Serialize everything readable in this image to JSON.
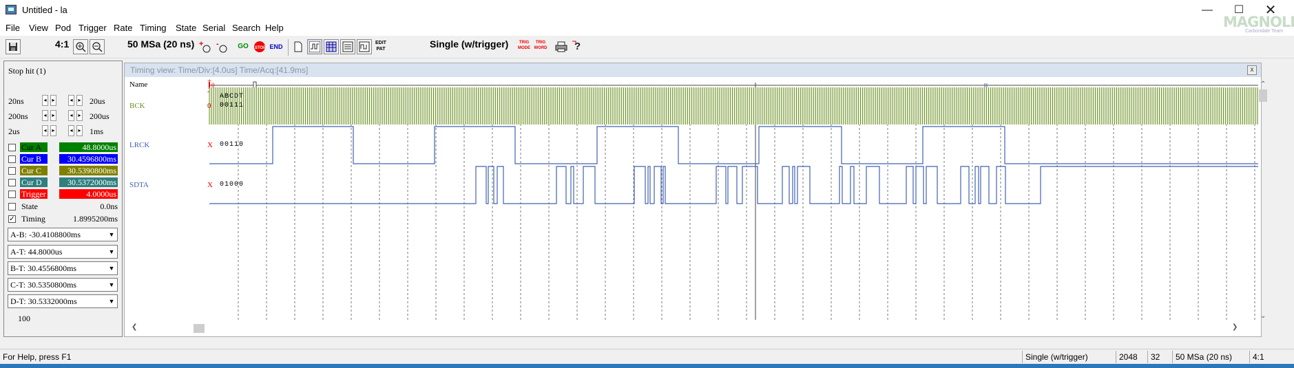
{
  "window": {
    "title": "Untitled - la",
    "minimize": "—",
    "maximize": "☐",
    "close": "✕"
  },
  "logo": {
    "main": "MAGNOLI",
    "sub": "Carbondale Team"
  },
  "menu": [
    "File",
    "View",
    "Pod",
    "Trigger",
    "Rate",
    "Timing",
    "State",
    "Serial",
    "Search",
    "Help"
  ],
  "toolbar": {
    "zoom_ratio": "4:1",
    "sample_rate": "50 MSa  (20 ns)",
    "go_label": "GO",
    "stop_label": "STOP",
    "end_label": "END",
    "edit_pat_label": "EDIT PAT",
    "trig_mode_label": "TRIG MODE",
    "trig_word_label": "TRIG WORD",
    "acq_mode": "Single (w/trigger)"
  },
  "left_panel": {
    "stop_hit": "Stop hit (1)",
    "spin_rows": [
      {
        "left": "20ns",
        "right": "20us"
      },
      {
        "left": "200ns",
        "right": "200us"
      },
      {
        "left": "2us",
        "right": "1ms"
      }
    ],
    "cursors": [
      {
        "label": "Cur A",
        "value": "48.8000us",
        "label_color": "#008000",
        "value_color": "#008000",
        "checked": false
      },
      {
        "label": "Cur B",
        "value": "30.4596800ms",
        "label_color": "#0000ff",
        "value_color": "#0000ff",
        "checked": false
      },
      {
        "label": "Cur C",
        "value": "30.5390800ms",
        "label_color": "#808000",
        "value_color": "#808000",
        "checked": false
      },
      {
        "label": "Cur D",
        "value": "30.5372000ms",
        "label_color": "#2f7f7f",
        "value_color": "#2f7f7f",
        "checked": false
      },
      {
        "label": "Trigger",
        "value": "4.0000us",
        "label_color": "#ff0000",
        "value_color": "#ff0000",
        "checked": false
      }
    ],
    "state": {
      "label": "State",
      "value": "0.0ns",
      "checked": false
    },
    "timing": {
      "label": "Timing",
      "value": "1.8995200ms",
      "checked": true
    },
    "dropdowns": [
      "A-B: -30.4108800ms",
      "A-T: 44.8000us",
      "B-T: 30.4556800ms",
      "C-T: 30.5350800ms",
      "D-T: 30.5332000ms"
    ],
    "count": "100"
  },
  "timing_view": {
    "title": "Timing view:  Time/Div:[4.0us] Time/Acq:[41.9ms]",
    "close": "x",
    "name_header": "Name",
    "plus": "+",
    "minus": "-",
    "zero": "0",
    "cols_header": "ABCDT",
    "signals": [
      {
        "name": "BCK",
        "trig": "0",
        "bits": "00111"
      },
      {
        "name": "LRCK",
        "trig": "X",
        "bits": "00110"
      },
      {
        "name": "SDTA",
        "trig": "X",
        "bits": "01000"
      }
    ]
  },
  "status": {
    "help": "For Help, press F1",
    "mode": "Single (w/trigger)",
    "depth": "2048",
    "width": "32",
    "rate": "50 MSa  (20 ns)",
    "zoom": "4:1"
  },
  "colors": {
    "bck": "#6b8e23",
    "lrck": "#4060b0",
    "sdta": "#4060b0"
  }
}
